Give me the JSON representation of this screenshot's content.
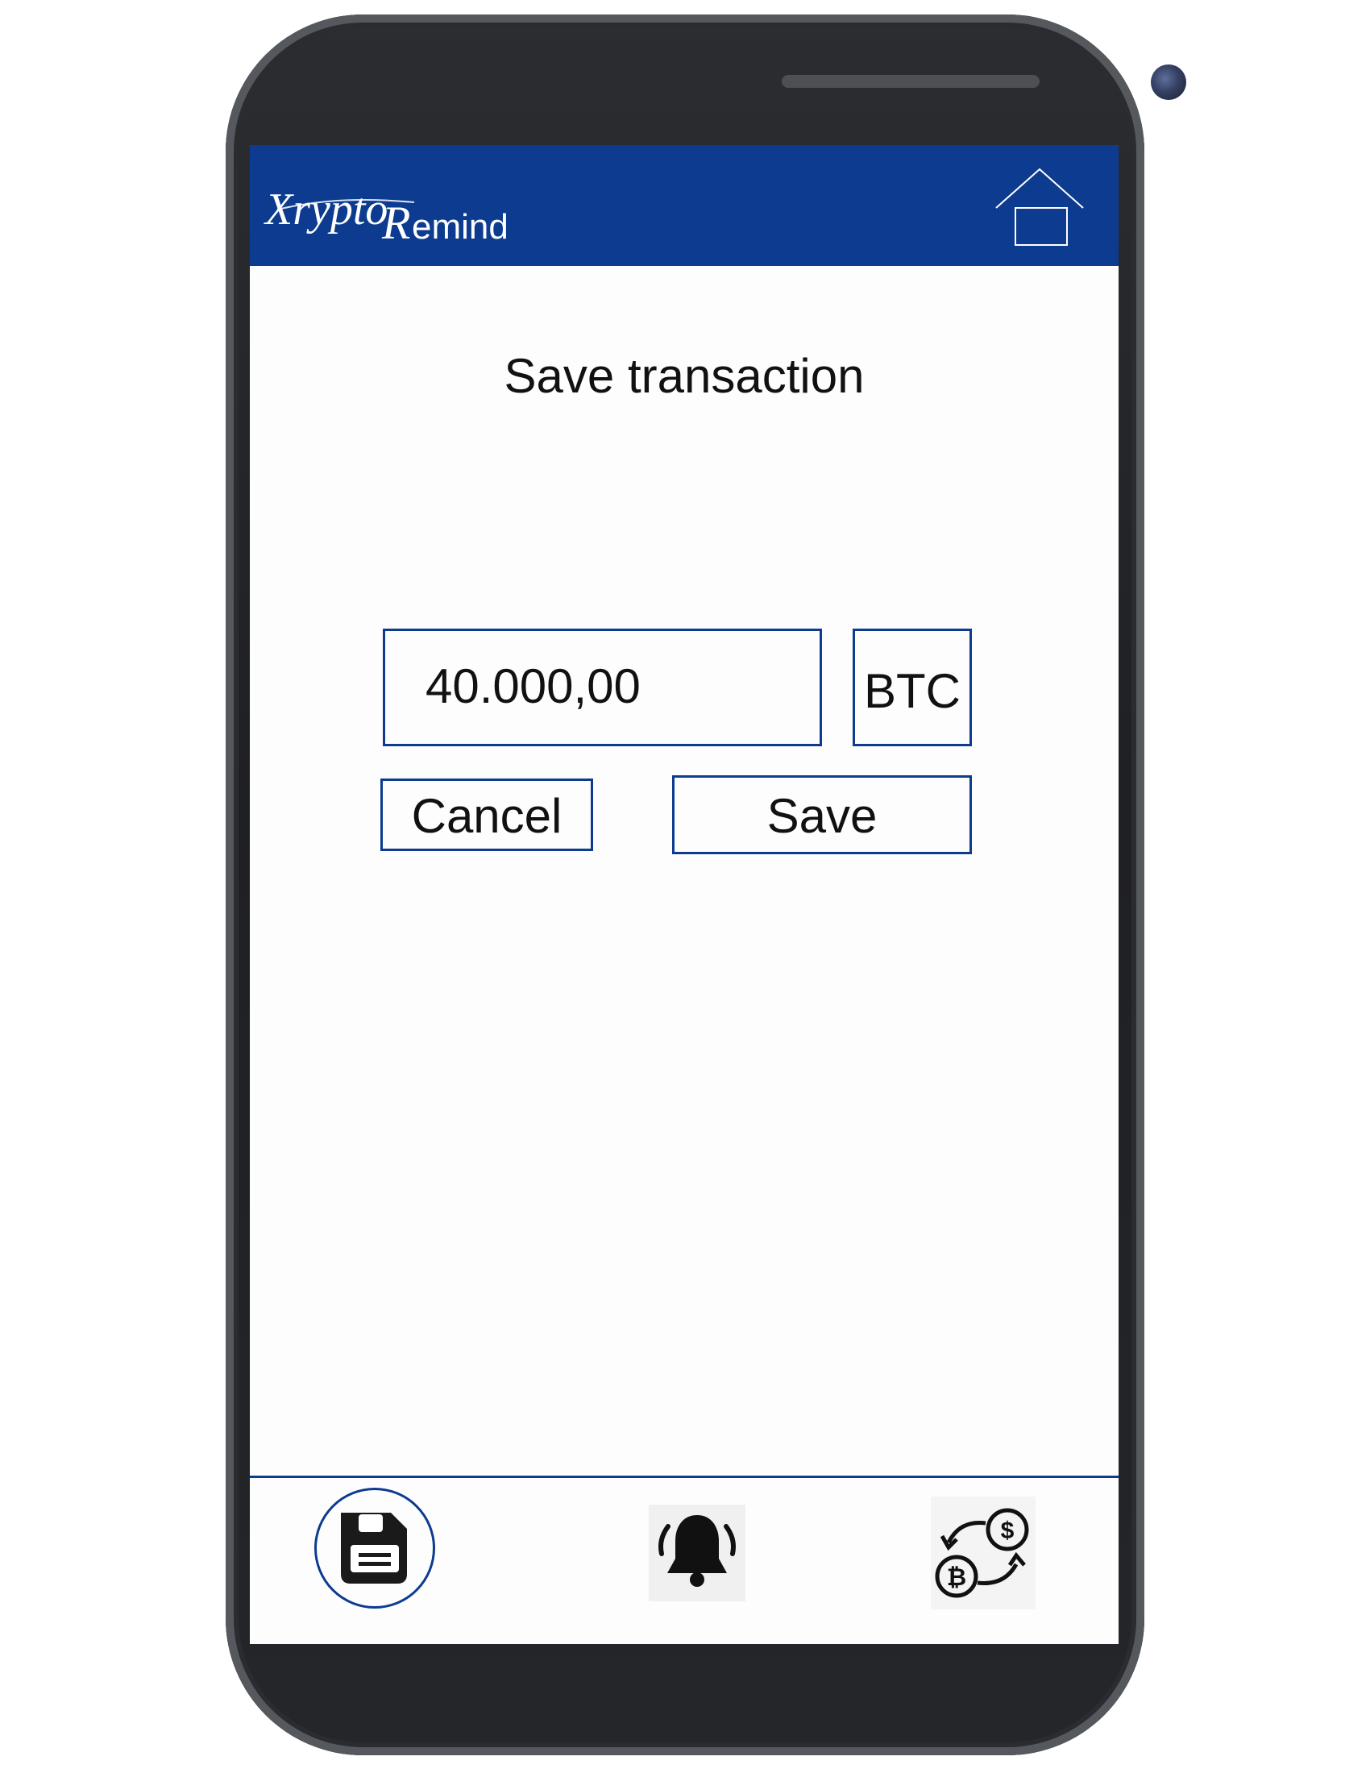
{
  "app": {
    "logo_text": "XryptoRemind"
  },
  "header": {
    "home_icon": "home-icon"
  },
  "page": {
    "title": "Save transaction"
  },
  "form": {
    "amount_value": "40.000,00",
    "currency": "BTC",
    "cancel_label": "Cancel",
    "save_label": "Save"
  },
  "bottom_nav": {
    "items": [
      {
        "icon": "save-icon",
        "active": true
      },
      {
        "icon": "bell-icon",
        "active": false
      },
      {
        "icon": "exchange-icon",
        "active": false
      }
    ]
  },
  "colors": {
    "brand": "#0c3b8f",
    "background": "#fdfdfd",
    "text": "#111111"
  }
}
